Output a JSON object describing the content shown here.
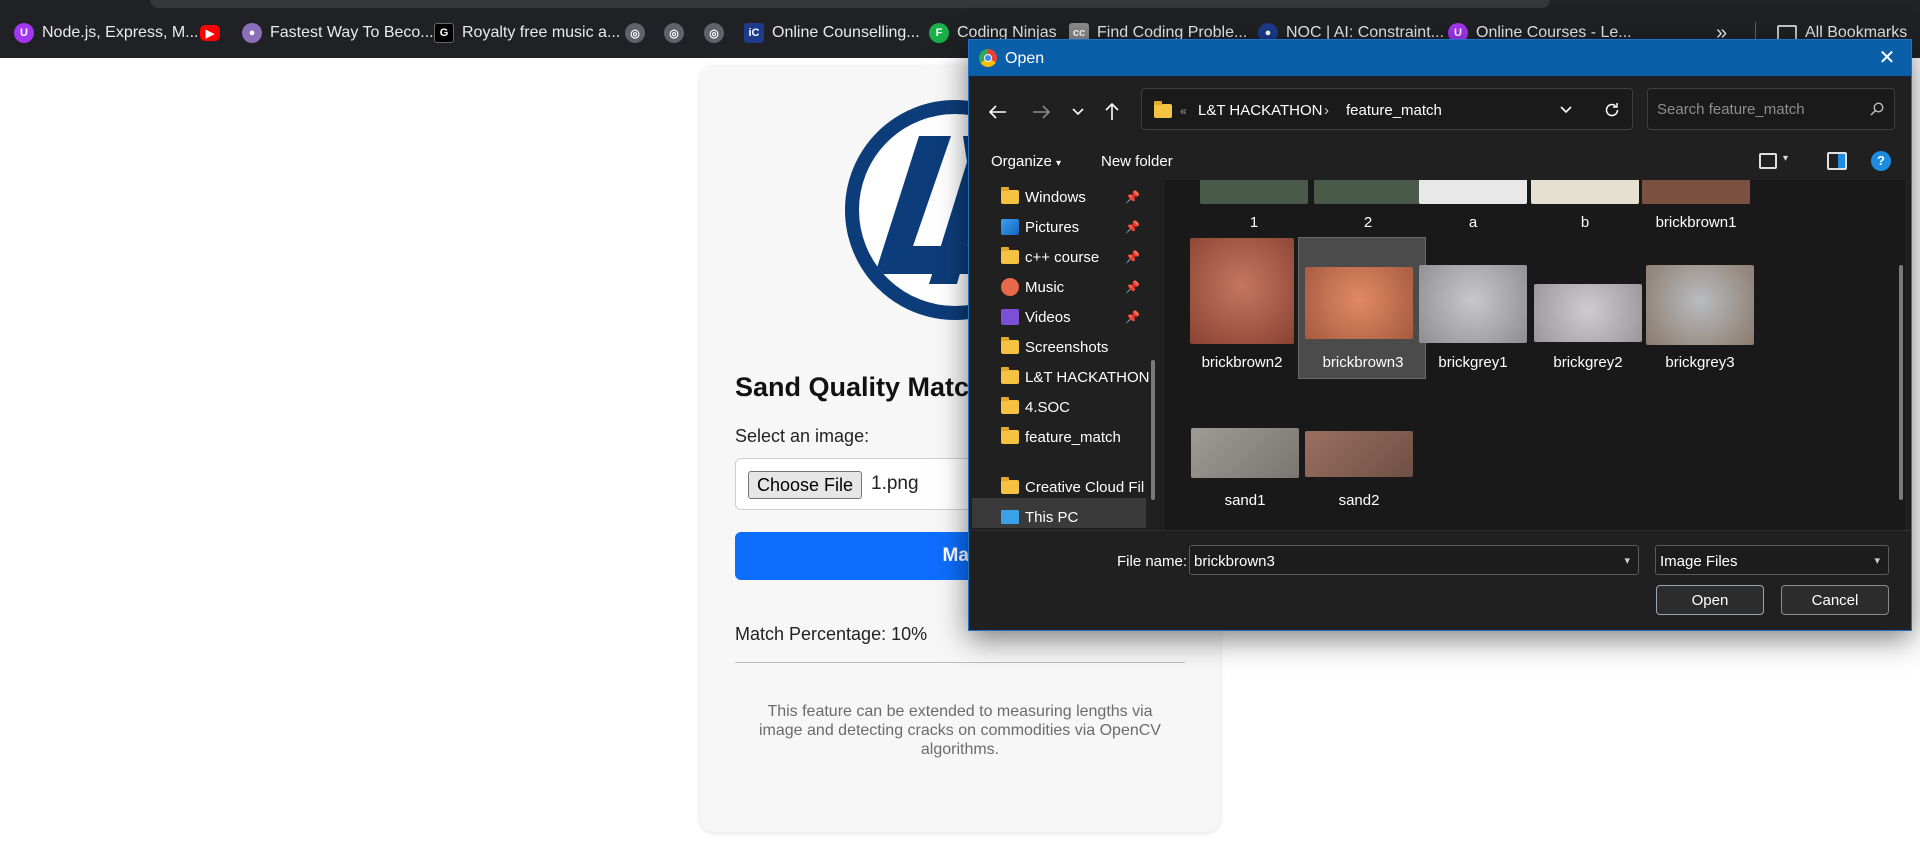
{
  "bookmarks": {
    "items": [
      {
        "label": "Node.js, Express, M..."
      },
      {
        "label": ""
      },
      {
        "label": "Fastest Way To Beco..."
      },
      {
        "label": "Royalty free music a..."
      },
      {
        "label": ""
      },
      {
        "label": ""
      },
      {
        "label": ""
      },
      {
        "label": "Online Counselling..."
      },
      {
        "label": "Coding Ninjas"
      },
      {
        "label": "Find Coding Proble..."
      },
      {
        "label": "NOC | AI: Constraint..."
      },
      {
        "label": "Online Courses - Le..."
      }
    ],
    "overflow": "»",
    "all_bookmarks": "All Bookmarks",
    "colors": {
      "udemy": "#a435f0",
      "youtube": "#ff0000",
      "coding_ninjas": "#19b04b",
      "cc": "#8a8a8a",
      "noc": "#1a3a8a"
    }
  },
  "page": {
    "title": "Sand Quality Match",
    "select_label": "Select an image:",
    "choose_file": "Choose File",
    "file_name": "1.png",
    "match_button": "Match",
    "match_percentage": "Match Percentage: 10%",
    "footer": "This feature can be extended to measuring lengths via image and detecting cracks on commodities via OpenCV algorithms.",
    "accent": "#0d6efd",
    "logo_color": "#0c3d7a"
  },
  "dialog": {
    "title": "Open",
    "close": "✕",
    "breadcrumb": [
      "L&T HACKATHON",
      "feature_match"
    ],
    "breadcrumb_overflow": "«",
    "search_placeholder": "Search feature_match",
    "organize": "Organize",
    "new_folder": "New folder",
    "sidebar": [
      {
        "label": "Windows",
        "icon": "folder-icon",
        "pinned": true
      },
      {
        "label": "Pictures",
        "icon": "pictures-icon",
        "pinned": true
      },
      {
        "label": "c++ course",
        "icon": "folder-icon",
        "pinned": true
      },
      {
        "label": "Music",
        "icon": "music-icon",
        "pinned": true
      },
      {
        "label": "Videos",
        "icon": "videos-icon",
        "pinned": true
      },
      {
        "label": "Screenshots",
        "icon": "folder-icon",
        "pinned": false
      },
      {
        "label": "L&T HACKATHON",
        "icon": "folder-icon",
        "pinned": false,
        "selected": true
      },
      {
        "label": "4.SOC",
        "icon": "folder-icon",
        "pinned": false
      },
      {
        "label": "feature_match",
        "icon": "folder-icon",
        "pinned": false
      },
      {
        "label": "Creative Cloud Fil",
        "icon": "folder-icon",
        "pinned": false
      },
      {
        "label": "This PC",
        "icon": "pc-icon",
        "pinned": false
      }
    ],
    "files": [
      {
        "name": "1",
        "color": "#4a5a48"
      },
      {
        "name": "2",
        "color": "#4a5a48"
      },
      {
        "name": "a",
        "color": "#e8e8e8"
      },
      {
        "name": "b",
        "color": "#e6e0d0"
      },
      {
        "name": "brickbrown1",
        "color": "#7a5040"
      },
      {
        "name": "brickbrown2",
        "color": "#b5634a"
      },
      {
        "name": "brickbrown3",
        "color": "#c8704e",
        "selected": true
      },
      {
        "name": "brickgrey1",
        "color": "#a8a8ac"
      },
      {
        "name": "brickgrey2",
        "color": "#b4b0b4"
      },
      {
        "name": "brickgrey3",
        "color": "#a0a4a8"
      },
      {
        "name": "sand1",
        "color": "#8e8a84"
      },
      {
        "name": "sand2",
        "color": "#8a6a5a"
      }
    ],
    "file_name_label": "File name:",
    "file_name_value": "brickbrown3",
    "file_type": "Image Files",
    "open_button": "Open",
    "cancel_button": "Cancel",
    "colors": {
      "titlebar": "#0b5ea8",
      "background": "#202020",
      "folder": "#f5c242"
    }
  }
}
